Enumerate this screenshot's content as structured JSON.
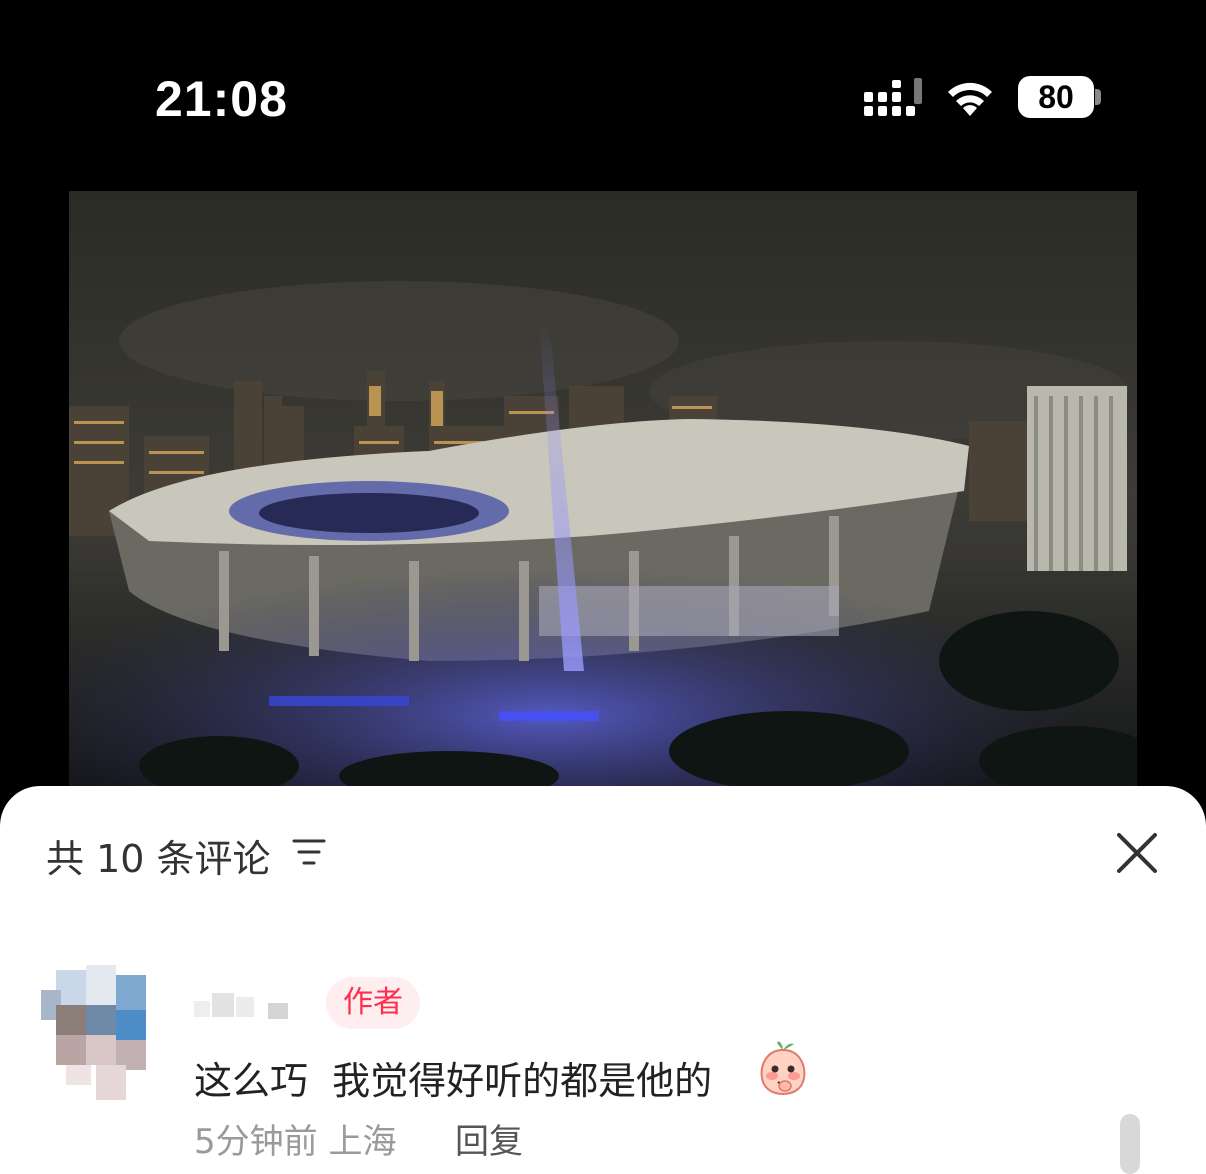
{
  "status_bar": {
    "time": "21:08",
    "battery_level": "80",
    "icons": [
      "signal-icon",
      "wifi-icon",
      "battery-icon"
    ]
  },
  "comments_panel": {
    "title": "共 10 条评论",
    "sort_icon": "sort-icon",
    "close_icon": "close-icon",
    "comments": [
      {
        "badge": "作者",
        "text": "这么巧  我觉得好听的都是他的",
        "emoji": "blushing-peach-emoji",
        "time": "5分钟前",
        "location": "上海",
        "reply_label": "回复"
      }
    ]
  },
  "colors": {
    "badge_bg": "#ffeef0",
    "badge_text": "#ff2e4d",
    "meta_text": "#9a9a9a"
  }
}
